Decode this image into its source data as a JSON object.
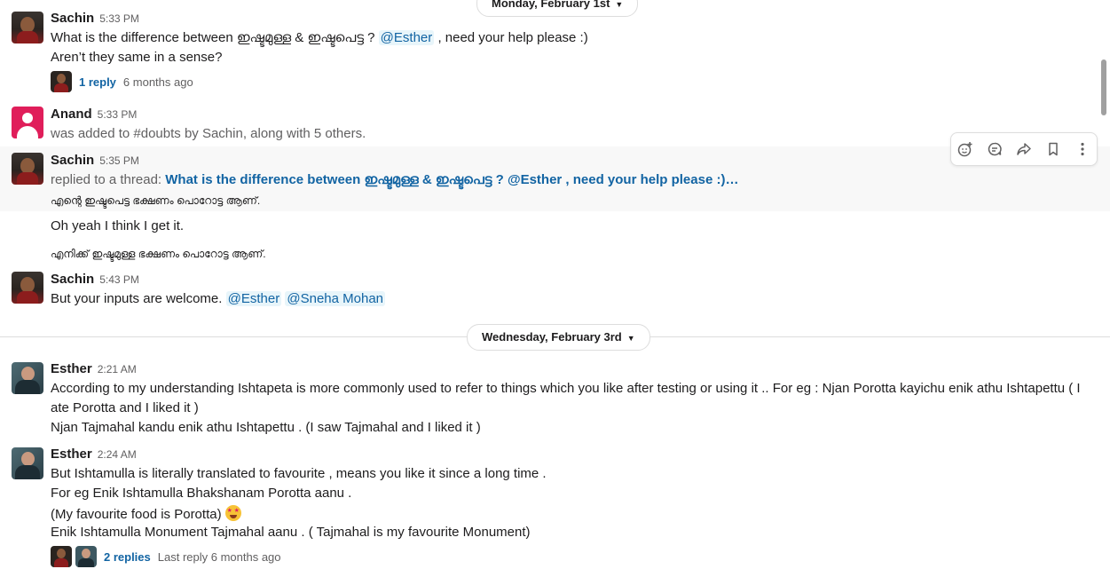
{
  "dates": {
    "monday": "Monday, February 1st",
    "wednesday": "Wednesday, February 3rd"
  },
  "messages": {
    "m1": {
      "author": "Sachin",
      "time": "5:33 PM",
      "line1_prefix": "What is the difference between ഇഷ്ടമുള്ള & ഇഷ്ടപെട്ട ?",
      "mention": "@Esther",
      "line1_suffix": ", need your help please :)",
      "line2": "Aren’t they same in a sense?",
      "reply_count": "1 reply",
      "reply_time": "6 months ago"
    },
    "m2": {
      "author": "Anand",
      "time": "5:33 PM",
      "text": "was added to #doubts by Sachin, along with 5 others."
    },
    "m3": {
      "author": "Sachin",
      "time": "5:35 PM",
      "replied_prefix": "replied to a thread:",
      "thread_link": "What is the difference between ഇഷ്ടമുള്ള & ഇഷ്ടപെട്ട ? @Esther , need your help please :)…",
      "ml_line1": "എന്റെ ഇഷ്ടപെട്ട ഭക്ഷണം പൊറോട്ട ആണ്.",
      "text2": "Oh yeah I think I get it.",
      "ml_line2": "എനിക്ക് ഇഷ്ടമുള്ള ഭക്ഷണം പൊറോട്ട ആണ്."
    },
    "m4": {
      "author": "Sachin",
      "time": "5:43 PM",
      "text": "But your inputs are welcome.",
      "mention1": "@Esther",
      "mention2": "@Sneha Mohan"
    },
    "m5": {
      "author": "Esther",
      "time": "2:21 AM",
      "line1": "According to my understanding Ishtapeta is more commonly used to refer to things which you  like  after testing  or using it .. For eg : Njan Porotta kayichu enik athu Ishtapettu ( I",
      "line2": "ate Porotta and I liked  it )",
      "line3": "Njan Tajmahal kandu enik athu Ishtapettu . (I saw Tajmahal and I liked it )"
    },
    "m6": {
      "author": "Esther",
      "time": "2:24 AM",
      "line1": "But Ishtamulla is literally translated to favourite , means you like it since a long time .",
      "line2": "For eg Enik Ishtamulla Bhakshanam Porotta aanu .",
      "line3": "(My favourite food is Porotta)",
      "line4": "Enik Ishtamulla Monument Tajmahal aanu . ( Tajmahal is my favourite Monument)",
      "reply_count": "2 replies",
      "reply_time": "Last reply 6 months ago"
    }
  },
  "hover_actions": [
    "add-reaction-icon",
    "reply-in-thread-icon",
    "share-icon",
    "bookmark-icon",
    "more-actions-icon"
  ]
}
